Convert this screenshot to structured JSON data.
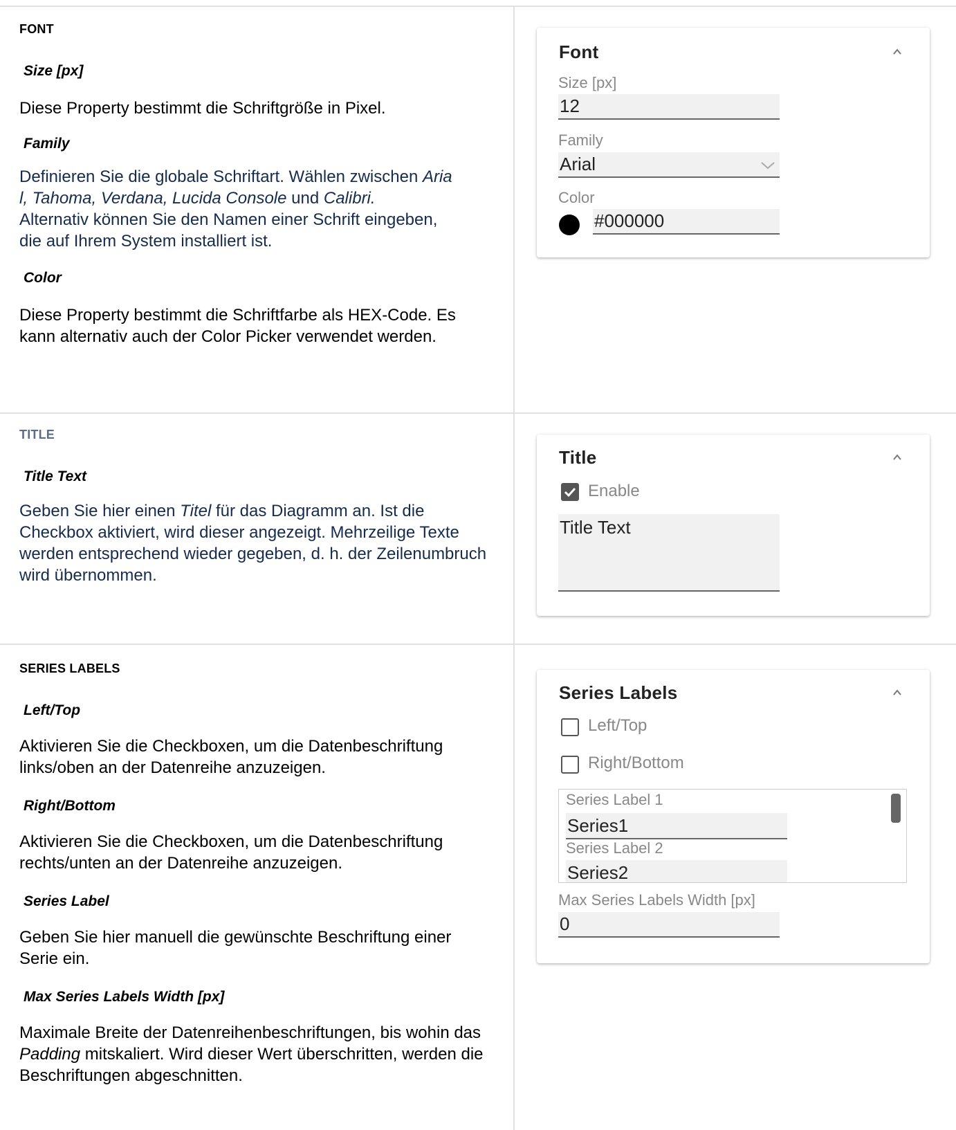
{
  "font_section": {
    "heading": "FONT",
    "size_title": "Size [px]",
    "size_desc": "Diese Property bestimmt die Schriftgröße in Pixel.",
    "family_title": "Family",
    "family_desc_1": "Definieren Sie die globale Schriftart. Wählen zwischen ",
    "family_desc_fonts_1": "Aria",
    "family_desc_fonts_2": "l, Tahoma, Verdana, Lucida Console",
    "family_desc_und": " und ",
    "family_desc_calibri": "Calibri.",
    "family_desc_2": "Alternativ können Sie den Namen einer Schrift eingeben,",
    "family_desc_3": "die auf Ihrem System installiert ist.",
    "color_title": "Color",
    "color_desc": "Diese Property bestimmt die Schriftfarbe als HEX-Code. Es kann alternativ auch der Color Picker verwendet werden.",
    "panel": {
      "title": "Font",
      "size_label": "Size [px]",
      "size_value": "12",
      "family_label": "Family",
      "family_value": "Arial",
      "color_label": "Color",
      "color_value": "#000000",
      "swatch_color": "#000000"
    }
  },
  "title_section": {
    "heading": "TITLE",
    "text_title": "Title Text",
    "desc_1": "Geben Sie hier einen ",
    "desc_italic": "Titel",
    "desc_2": " für das Diagramm an. Ist die Checkbox aktiviert, wird dieser angezeigt. Mehrzeilige Texte werden entsprechend wieder gegeben, d. h. der Zeilenumbruch wird übernommen.",
    "panel": {
      "title": "Title",
      "enable_label": "Enable",
      "enable_checked": true,
      "text_value": "Title Text"
    }
  },
  "series_section": {
    "heading": "SERIES LABELS",
    "lefttop_title": "Left/Top",
    "lefttop_desc": "Aktivieren Sie die Checkboxen, um die Datenbeschriftung links/oben an der Datenreihe anzuzeigen.",
    "rightbottom_title": "Right/Bottom",
    "rightbottom_desc": "Aktivieren Sie die Checkboxen, um die Datenbeschriftung rechts/unten an der Datenreihe anzuzeigen.",
    "label_title": "Series Label",
    "label_desc": "Geben Sie hier manuell die gewünschte Beschriftung einer Serie ein.",
    "maxwidth_title": "Max Series Labels Width [px]",
    "maxwidth_desc_1": "Maximale Breite der Datenreihenbeschriftungen, bis wohin das ",
    "maxwidth_desc_italic": "Padding",
    "maxwidth_desc_2": " mitskaliert. Wird dieser Wert überschritten, werden die Beschriftungen abgeschnitten.",
    "panel": {
      "title": "Series Labels",
      "lefttop_label": "Left/Top",
      "rightbottom_label": "Right/Bottom",
      "series_label_1": "Series Label 1",
      "series_value_1": "Series1",
      "series_label_2": "Series Label 2",
      "series_value_2": "Series2",
      "maxwidth_label": "Max Series Labels Width [px]",
      "maxwidth_value": "0"
    }
  }
}
